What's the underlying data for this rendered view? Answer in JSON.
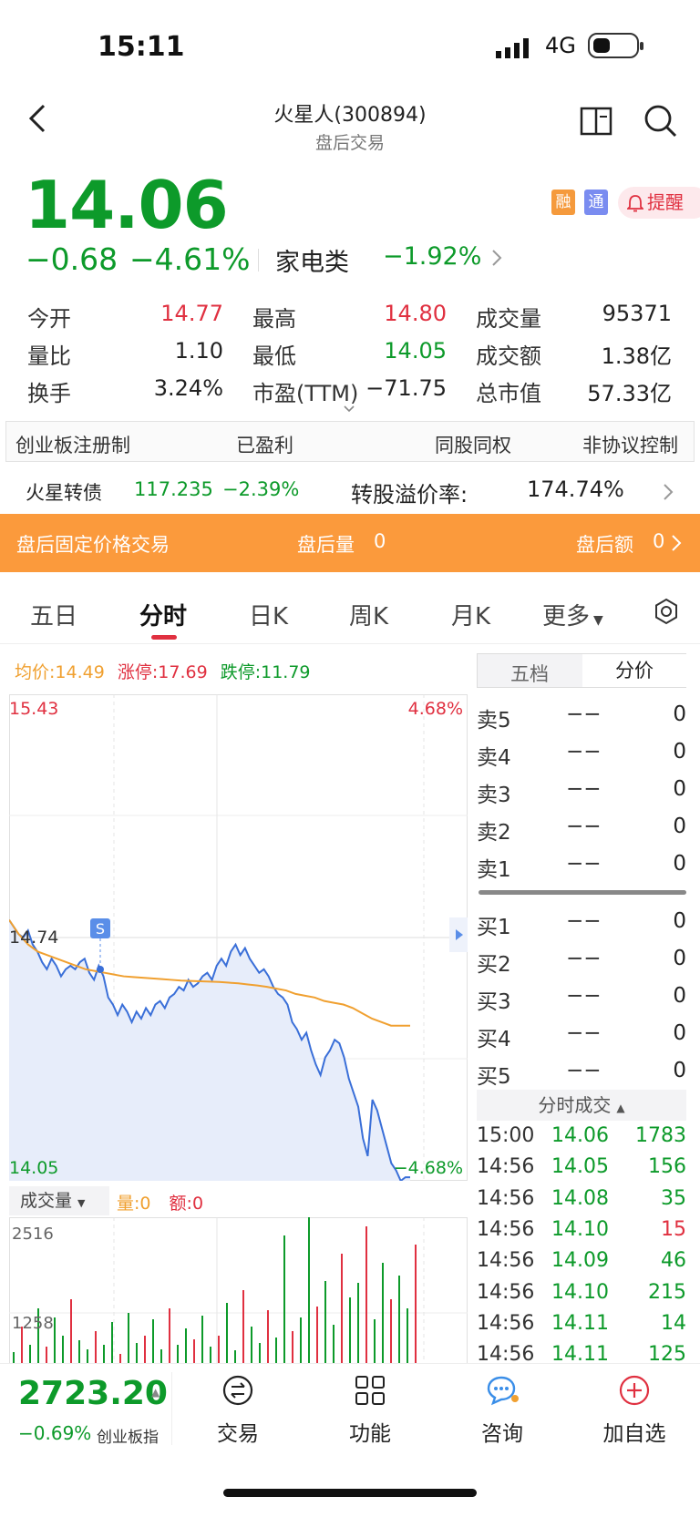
{
  "status": {
    "time": "15:11",
    "network": "4G"
  },
  "header": {
    "title": "火星人(300894)",
    "subtitle": "盘后交易"
  },
  "quote": {
    "price": "14.06",
    "change": "−0.68",
    "change_pct": "−4.61%",
    "sector": "家电类",
    "sector_pct": "−1.92%",
    "badges": [
      "融",
      "通"
    ],
    "remind_label": "提醒"
  },
  "stats": [
    {
      "label": "今开",
      "value": "14.77",
      "color": "#e03040"
    },
    {
      "label": "最高",
      "value": "14.80",
      "color": "#e03040"
    },
    {
      "label": "成交量",
      "value": "95371",
      "color": "#222222"
    },
    {
      "label": "量比",
      "value": "1.10",
      "color": "#222222"
    },
    {
      "label": "最低",
      "value": "14.05",
      "color": "#0d9a2a"
    },
    {
      "label": "成交额",
      "value": "1.38亿",
      "color": "#222222"
    },
    {
      "label": "换手",
      "value": "3.24%",
      "color": "#222222"
    },
    {
      "label": "市盈(TTM)",
      "value": "−71.75",
      "color": "#222222"
    },
    {
      "label": "总市值",
      "value": "57.33亿",
      "color": "#222222"
    }
  ],
  "tags": [
    "创业板注册制",
    "已盈利",
    "同股同权",
    "非协议控制"
  ],
  "bond": {
    "name": "火星转债",
    "price": "117.235",
    "pct": "−2.39%",
    "premium_label": "转股溢价率:",
    "premium": "174.74%"
  },
  "after_hours": {
    "title": "盘后固定价格交易",
    "vol_label": "盘后量",
    "vol": "0",
    "amt_label": "盘后额",
    "amt": "0"
  },
  "tabs": [
    "五日",
    "分时",
    "日K",
    "周K",
    "月K",
    "更多"
  ],
  "chart_info": {
    "avg_label": "均价:",
    "avg": "14.49",
    "limit_up_label": "涨停:",
    "limit_up": "17.69",
    "limit_down_label": "跌停:",
    "limit_down": "11.79"
  },
  "chart_data": {
    "type": "line",
    "ylim": [
      14.05,
      15.43
    ],
    "y_tick_labels": {
      "top_left": "15.43",
      "top_right": "4.68%",
      "mid_left": "14.74",
      "bottom_left": "14.05",
      "bottom_right": "−4.68%"
    },
    "series": [
      {
        "name": "price",
        "color": "#3a6fd8",
        "values": [
          14.79,
          14.77,
          14.75,
          14.74,
          14.76,
          14.72,
          14.7,
          14.67,
          14.65,
          14.68,
          14.66,
          14.63,
          14.65,
          14.66,
          14.65,
          14.67,
          14.68,
          14.64,
          14.62,
          14.66,
          14.63,
          14.57,
          14.55,
          14.52,
          14.55,
          14.53,
          14.5,
          14.53,
          14.51,
          14.54,
          14.52,
          14.55,
          14.56,
          14.54,
          14.57,
          14.58,
          14.6,
          14.59,
          14.62,
          14.6,
          14.61,
          14.63,
          14.64,
          14.62,
          14.66,
          14.68,
          14.66,
          14.7,
          14.72,
          14.69,
          14.71,
          14.68,
          14.66,
          14.64,
          14.65,
          14.63,
          14.6,
          14.58,
          14.57,
          14.55,
          14.5,
          14.48,
          14.45,
          14.47,
          14.42,
          14.38,
          14.35,
          14.4,
          14.42,
          14.45,
          14.44,
          14.4,
          14.34,
          14.3,
          14.26,
          14.17,
          14.12,
          14.28,
          14.25,
          14.2,
          14.15,
          14.1,
          14.08,
          14.05,
          14.06,
          14.06
        ]
      },
      {
        "name": "avg",
        "color": "#f0a030",
        "values": [
          14.79,
          14.75,
          14.72,
          14.7,
          14.69,
          14.68,
          14.67,
          14.66,
          14.65,
          14.645,
          14.64,
          14.635,
          14.63,
          14.628,
          14.626,
          14.624,
          14.622,
          14.62,
          14.618,
          14.617,
          14.616,
          14.615,
          14.614,
          14.612,
          14.61,
          14.607,
          14.604,
          14.6,
          14.595,
          14.59,
          14.58,
          14.575,
          14.57,
          14.56,
          14.555,
          14.55,
          14.54,
          14.525,
          14.51,
          14.5,
          14.49,
          14.49,
          14.49
        ]
      }
    ],
    "volume": {
      "label": "成交量",
      "vol_label": "量:",
      "vol": "0",
      "amt_label": "额:",
      "amt": "0",
      "ticks": [
        "2516",
        "1258"
      ]
    }
  },
  "orderbook": {
    "tabs": [
      "五档",
      "分价"
    ],
    "sell": [
      {
        "label": "卖5",
        "price": "−−",
        "vol": "0"
      },
      {
        "label": "卖4",
        "price": "−−",
        "vol": "0"
      },
      {
        "label": "卖3",
        "price": "−−",
        "vol": "0"
      },
      {
        "label": "卖2",
        "price": "−−",
        "vol": "0"
      },
      {
        "label": "卖1",
        "price": "−−",
        "vol": "0"
      }
    ],
    "buy": [
      {
        "label": "买1",
        "price": "−−",
        "vol": "0"
      },
      {
        "label": "买2",
        "price": "−−",
        "vol": "0"
      },
      {
        "label": "买3",
        "price": "−−",
        "vol": "0"
      },
      {
        "label": "买4",
        "price": "−−",
        "vol": "0"
      },
      {
        "label": "买5",
        "price": "−−",
        "vol": "0"
      }
    ]
  },
  "trades": {
    "title": "分时成交",
    "rows": [
      {
        "time": "15:00",
        "price": "14.06",
        "vol": "1783",
        "vol_color": "#0d9a2a"
      },
      {
        "time": "14:56",
        "price": "14.05",
        "vol": "156",
        "vol_color": "#0d9a2a"
      },
      {
        "time": "14:56",
        "price": "14.08",
        "vol": "35",
        "vol_color": "#0d9a2a"
      },
      {
        "time": "14:56",
        "price": "14.10",
        "vol": "15",
        "vol_color": "#e03040"
      },
      {
        "time": "14:56",
        "price": "14.09",
        "vol": "46",
        "vol_color": "#0d9a2a"
      },
      {
        "time": "14:56",
        "price": "14.10",
        "vol": "215",
        "vol_color": "#0d9a2a"
      },
      {
        "time": "14:56",
        "price": "14.11",
        "vol": "14",
        "vol_color": "#0d9a2a"
      },
      {
        "time": "14:56",
        "price": "14.11",
        "vol": "125",
        "vol_color": "#0d9a2a"
      }
    ]
  },
  "index": {
    "value": "2723.20",
    "pct": "−0.69%",
    "name": "创业板指"
  },
  "bottom_nav": [
    {
      "label": "交易",
      "icon": "exchange-icon"
    },
    {
      "label": "功能",
      "icon": "grid-icon"
    },
    {
      "label": "咨询",
      "icon": "chat-icon"
    },
    {
      "label": "加自选",
      "icon": "plus-circle-icon"
    }
  ]
}
